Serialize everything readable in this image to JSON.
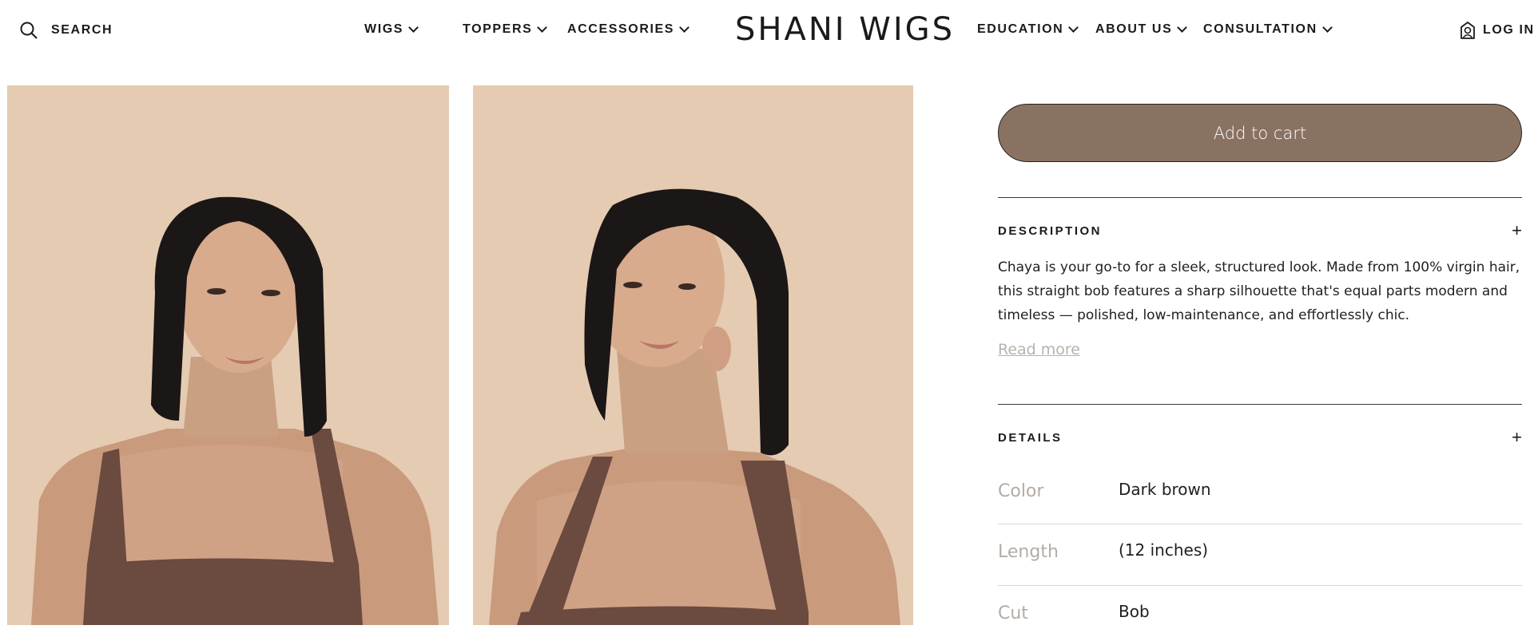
{
  "header": {
    "search_label": "SEARCH",
    "nav_left": [
      {
        "label": "WIGS"
      },
      {
        "label": "TOPPERS"
      },
      {
        "label": "ACCESSORIES"
      }
    ],
    "logo": "SHANI WIGS",
    "nav_right": [
      {
        "label": "EDUCATION"
      },
      {
        "label": "ABOUT US"
      },
      {
        "label": "CONSULTATION"
      }
    ],
    "login_label": "LOG IN",
    "icons": {
      "search": "search-icon",
      "login": "user-icon",
      "chevron": "chevron-down-icon"
    }
  },
  "gallery": {
    "images": [
      "product-photo-front",
      "product-photo-side"
    ],
    "colors": {
      "backdrop": "#e4cbb2",
      "garment": "#6b4a3f",
      "hair": "#1b1716"
    }
  },
  "product": {
    "add_to_cart_label": "Add to cart",
    "description_title": "DESCRIPTION",
    "description_text": "Chaya is your go-to for a sleek, structured look. Made from 100% virgin hair, this straight bob features a sharp silhouette that's equal parts modern and timeless — polished, low-maintenance, and effortlessly chic.",
    "read_more_label": "Read more",
    "details_title": "DETAILS",
    "expand_symbol": "+",
    "details": [
      {
        "label": "Color",
        "value": "Dark brown"
      },
      {
        "label": "Length",
        "value": "(12 inches)"
      },
      {
        "label": "Cut",
        "value": "Bob"
      }
    ]
  },
  "colors": {
    "accent_button": "#8a7262",
    "muted_text": "#b3aca5"
  }
}
